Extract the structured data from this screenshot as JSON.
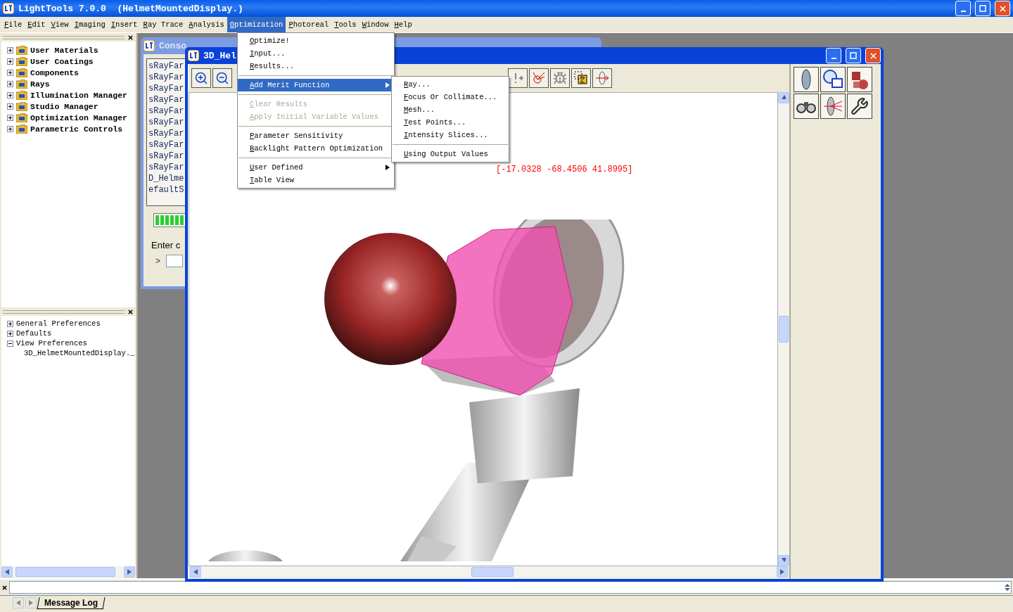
{
  "window": {
    "title": "LightTools 7.0.0  (HelmetMountedDisplay.)"
  },
  "menu_bar": [
    {
      "label": "File",
      "selected": false
    },
    {
      "label": "Edit",
      "selected": false
    },
    {
      "label": "View",
      "selected": false
    },
    {
      "label": "Imaging",
      "selected": false
    },
    {
      "label": "Insert",
      "selected": false
    },
    {
      "label": "Ray Trace",
      "selected": false
    },
    {
      "label": "Analysis",
      "selected": false
    },
    {
      "label": "Optimization",
      "selected": true
    },
    {
      "label": "Photoreal",
      "selected": false
    },
    {
      "label": "Tools",
      "selected": false
    },
    {
      "label": "Window",
      "selected": false
    },
    {
      "label": "Help",
      "selected": false
    }
  ],
  "optimization_menu": {
    "items": [
      {
        "kind": "item",
        "label": "Optimize!",
        "selected": false,
        "disabled": false
      },
      {
        "kind": "item",
        "label": "Input...",
        "selected": false,
        "disabled": false
      },
      {
        "kind": "item",
        "label": "Results...",
        "selected": false,
        "disabled": false
      },
      {
        "kind": "separator"
      },
      {
        "kind": "submenu",
        "label": "Add Merit Function",
        "selected": true,
        "disabled": false
      },
      {
        "kind": "separator"
      },
      {
        "kind": "item",
        "label": "Clear Results",
        "selected": false,
        "disabled": true
      },
      {
        "kind": "item",
        "label": "Apply Initial Variable Values",
        "selected": false,
        "disabled": true
      },
      {
        "kind": "separator"
      },
      {
        "kind": "item",
        "label": "Parameter Sensitivity",
        "selected": false,
        "disabled": false
      },
      {
        "kind": "item",
        "label": "Backlight Pattern Optimization",
        "selected": false,
        "disabled": false
      },
      {
        "kind": "separator"
      },
      {
        "kind": "submenu",
        "label": "User Defined",
        "selected": false,
        "disabled": false
      },
      {
        "kind": "item",
        "label": "Table View",
        "selected": false,
        "disabled": false
      }
    ]
  },
  "merit_function_submenu": {
    "items": [
      {
        "kind": "item",
        "label": "Ray...",
        "selected": false,
        "disabled": false
      },
      {
        "kind": "item",
        "label": "Focus Or Collimate...",
        "selected": false,
        "disabled": false
      },
      {
        "kind": "item",
        "label": "Mesh...",
        "selected": false,
        "disabled": false
      },
      {
        "kind": "item",
        "label": "Test Points...",
        "selected": false,
        "disabled": false
      },
      {
        "kind": "item",
        "label": "Intensity Slices...",
        "selected": false,
        "disabled": false
      },
      {
        "kind": "separator"
      },
      {
        "kind": "item",
        "label": "Using Output Values",
        "selected": false,
        "disabled": false
      }
    ]
  },
  "component_tree": {
    "items": [
      {
        "label": "User Materials",
        "expanded": false
      },
      {
        "label": "User Coatings",
        "expanded": false
      },
      {
        "label": "Components",
        "expanded": false
      },
      {
        "label": "Rays",
        "expanded": false
      },
      {
        "label": "Illumination Manager",
        "expanded": false
      },
      {
        "label": "Studio Manager",
        "expanded": false
      },
      {
        "label": "Optimization Manager",
        "expanded": false
      },
      {
        "label": "Parametric Controls",
        "expanded": false
      }
    ]
  },
  "preferences_tree": {
    "items": [
      {
        "label": "General Preferences",
        "expanded": false
      },
      {
        "label": "Defaults",
        "expanded": false
      },
      {
        "label": "View Preferences",
        "expanded": true,
        "children": [
          {
            "label": "3D_HelmetMountedDisplay._"
          }
        ]
      }
    ]
  },
  "console": {
    "title": "Conso",
    "lines": [
      "sRayFar",
      "sRayFar",
      "sRayFar",
      "sRayFar",
      "sRayFar",
      "sRayFar",
      "sRayFar",
      "sRayFar",
      "sRayFar",
      "sRayFar",
      "D_Helme",
      "efaultS"
    ],
    "progress": {
      "level": 1
    },
    "prompt_label": "Enter c",
    "prompt": ">"
  },
  "viewer": {
    "title": "3D_Hel",
    "coordinates": "[-17.0328 -68.4506 41.8995]"
  },
  "message_log": {
    "tab": "Message Log"
  }
}
